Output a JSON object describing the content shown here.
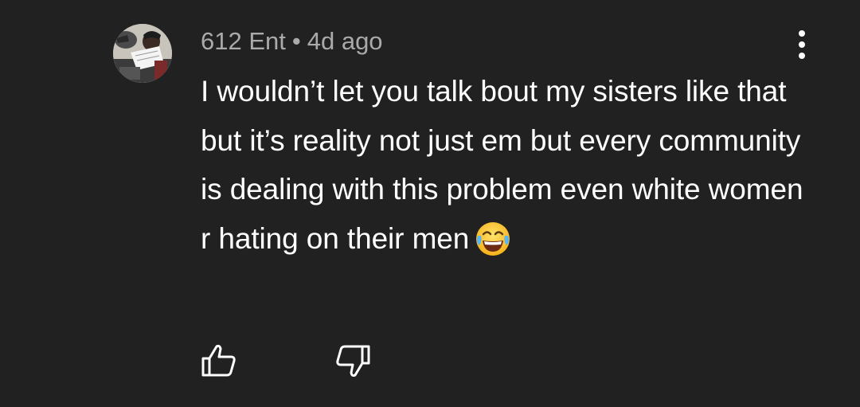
{
  "comment": {
    "author": "612 Ent",
    "separator": "•",
    "time": "4d ago",
    "text": "I wouldn’t let you talk bout my sisters like that but it’s reality not just em but every community is dealing with this problem even white women r hating on their men",
    "emoji": "face-with-tears-of-joy-emoji"
  },
  "actions": {
    "like_icon": "thumbs-up-icon",
    "dislike_icon": "thumbs-down-icon",
    "more_icon": "more-vertical-icon"
  },
  "colors": {
    "background": "#212121",
    "header_text": "#aaaaaa",
    "body_text": "#ffffff",
    "icon": "#ffffff"
  }
}
